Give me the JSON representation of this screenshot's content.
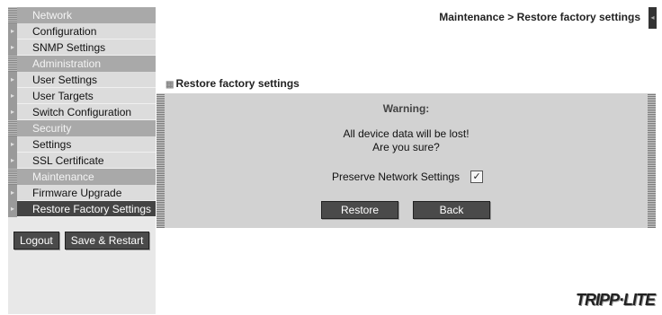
{
  "sidebar": {
    "groups": [
      {
        "header": "Network",
        "items": [
          "Configuration",
          "SNMP Settings"
        ]
      },
      {
        "header": "Administration",
        "items": [
          "User Settings",
          "User Targets",
          "Switch Configuration"
        ]
      },
      {
        "header": "Security",
        "items": [
          "Settings",
          "SSL Certificate"
        ]
      },
      {
        "header": "Maintenance",
        "items": [
          "Firmware Upgrade",
          "Restore Factory Settings"
        ]
      }
    ],
    "logout_label": "Logout",
    "save_restart_label": "Save & Restart"
  },
  "header": {
    "breadcrumb": "Maintenance > Restore factory settings"
  },
  "main": {
    "section_title": "Restore factory settings",
    "warning_title": "Warning:",
    "warning_line1": "All device data will be lost!",
    "warning_line2": "Are you sure?",
    "preserve_label": "Preserve Network Settings",
    "preserve_checked": true,
    "restore_label": "Restore",
    "back_label": "Back"
  },
  "logo": "TRIPP·LITE"
}
